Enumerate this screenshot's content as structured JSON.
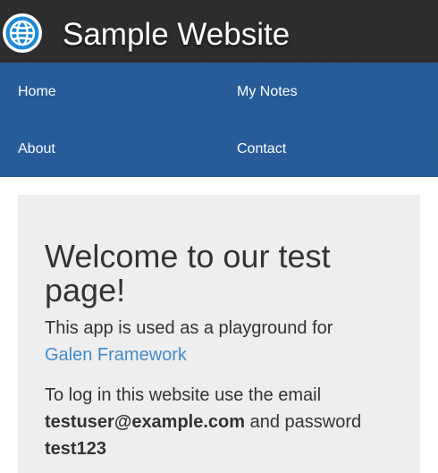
{
  "header": {
    "logo_icon": "globe-icon",
    "title": "Sample Website"
  },
  "nav": {
    "items": [
      {
        "label": "Home"
      },
      {
        "label": "My Notes"
      },
      {
        "label": "About"
      },
      {
        "label": "Contact"
      }
    ]
  },
  "welcome": {
    "heading": "Welcome to our test page!",
    "intro_text": "This app is used as a playground for",
    "link_text": "Galen Framework",
    "login_prefix": "To log in this website use the email",
    "email": "testuser@example.com",
    "password_label": "and password",
    "password": "test123"
  },
  "colors": {
    "header_bg": "#2b2b2b",
    "nav_bg": "#255b9a",
    "panel_bg": "#eeeeee",
    "link": "#428bca"
  }
}
